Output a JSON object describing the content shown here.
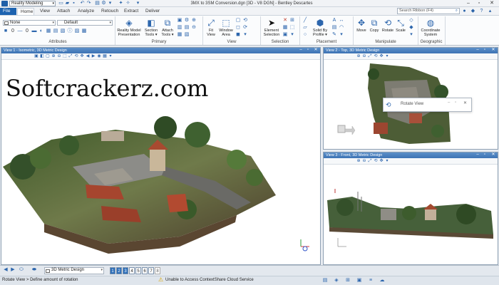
{
  "titlebar": {
    "workflow": "Reality Modeling",
    "title": "3MX to 3SM Conversion.dgn [3D - V8 DGN] - Bentley Descartes",
    "search_placeholder": "Search Ribbon (F4)"
  },
  "tabs": [
    "File",
    "Home",
    "View",
    "Attach",
    "Analyze",
    "Retouch",
    "Extract",
    "Deliver"
  ],
  "ribbon": {
    "attributes": {
      "level": "None",
      "style": "Default",
      "label": "Attributes"
    },
    "primary": {
      "label": "Primary",
      "buttons": [
        {
          "line1": "Reality Model",
          "line2": "Presentation"
        },
        {
          "line1": "Section",
          "line2": "Tools ▾"
        },
        {
          "line1": "Attach",
          "line2": "Tools ▾"
        }
      ]
    },
    "view": {
      "label": "View",
      "buttons": [
        {
          "line1": "Fit",
          "line2": "View"
        },
        {
          "line1": "Window",
          "line2": "Area"
        }
      ]
    },
    "selection": {
      "label": "Selection",
      "buttons": [
        {
          "line1": "Element",
          "line2": "Selection"
        }
      ]
    },
    "placement": {
      "label": "Placement",
      "buttons": [
        {
          "line1": "Solid By",
          "line2": "Profile ▾"
        }
      ]
    },
    "manipulate": {
      "label": "Manipulate",
      "buttons": [
        "Move",
        "Copy",
        "Rotate",
        "Scale"
      ]
    },
    "geographic": {
      "label": "Geographic",
      "buttons": [
        {
          "line1": "Coordinate",
          "line2": "System"
        }
      ]
    }
  },
  "views": {
    "v1": "View 1 - Isometric, 3D Metric Design",
    "v2": "View 2 - Top, 3D Metric Design",
    "v3": "View 3 - Front, 3D Metric Design"
  },
  "watermark": "Softcrackerz.com",
  "rotate_dialog": {
    "title": "Rotate View"
  },
  "viewbar": {
    "model": "3D Metric Design",
    "view_numbers": [
      "1",
      "2",
      "3",
      "4",
      "5",
      "6",
      "7",
      "8"
    ],
    "selected": [
      1,
      2,
      3
    ]
  },
  "status": {
    "prompt": "Rotate View > Define amount of rotation",
    "message": "Unable to Access ContextShare Cloud Service"
  },
  "colors": {
    "accent": "#1d63b0",
    "view_title": "#3d73b4"
  }
}
